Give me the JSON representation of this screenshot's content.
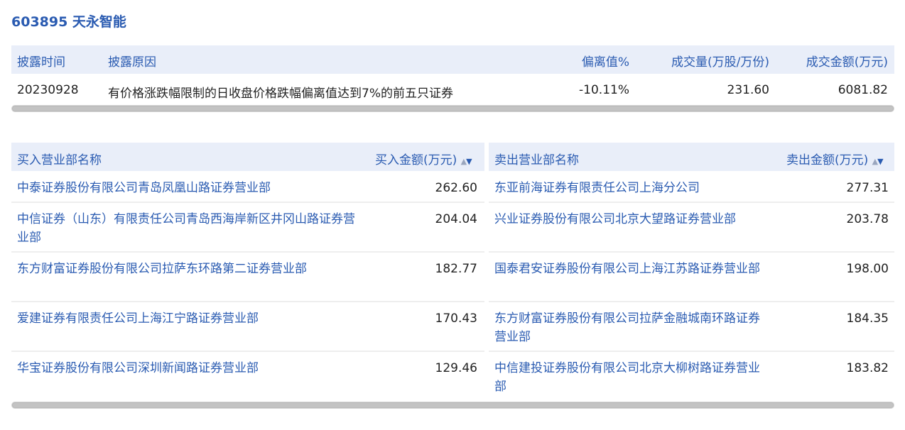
{
  "stock": {
    "title": "603895 天永智能"
  },
  "disclosure": {
    "headers": [
      "披露时间",
      "披露原因",
      "偏离值%",
      "成交量(万股/万份)",
      "成交金额(万元)"
    ],
    "row": [
      "20230928",
      "有价格涨跌幅限制的日收盘价格跌幅偏离值达到7%的前五只证券",
      "-10.11%",
      "231.60",
      "6081.82"
    ]
  },
  "buy": {
    "header_name": "买入营业部名称",
    "header_amount": "买入金额(万元)",
    "rows": [
      {
        "name": "中泰证券股份有限公司青岛凤凰山路证券营业部",
        "amount": "262.60"
      },
      {
        "name": "中信证券（山东）有限责任公司青岛西海岸新区井冈山路证券营业部",
        "amount": "204.04"
      },
      {
        "name": "东方财富证券股份有限公司拉萨东环路第二证券营业部",
        "amount": "182.77"
      },
      {
        "name": "爱建证券有限责任公司上海江宁路证券营业部",
        "amount": "170.43"
      },
      {
        "name": "华宝证券股份有限公司深圳新闻路证券营业部",
        "amount": "129.46"
      }
    ]
  },
  "sell": {
    "header_name": "卖出营业部名称",
    "header_amount": "卖出金额(万元)",
    "rows": [
      {
        "name": "东亚前海证券有限责任公司上海分公司",
        "amount": "277.31"
      },
      {
        "name": "兴业证券股份有限公司北京大望路证券营业部",
        "amount": "203.78"
      },
      {
        "name": "国泰君安证券股份有限公司上海江苏路证券营业部",
        "amount": "198.00"
      },
      {
        "name": "东方财富证券股份有限公司拉萨金融城南环路证券营业部",
        "amount": "184.35"
      },
      {
        "name": "中信建投证券股份有限公司北京大柳树路证券营业部",
        "amount": "183.82"
      }
    ]
  },
  "icons": {
    "sort": "sort-up-down-icon"
  }
}
